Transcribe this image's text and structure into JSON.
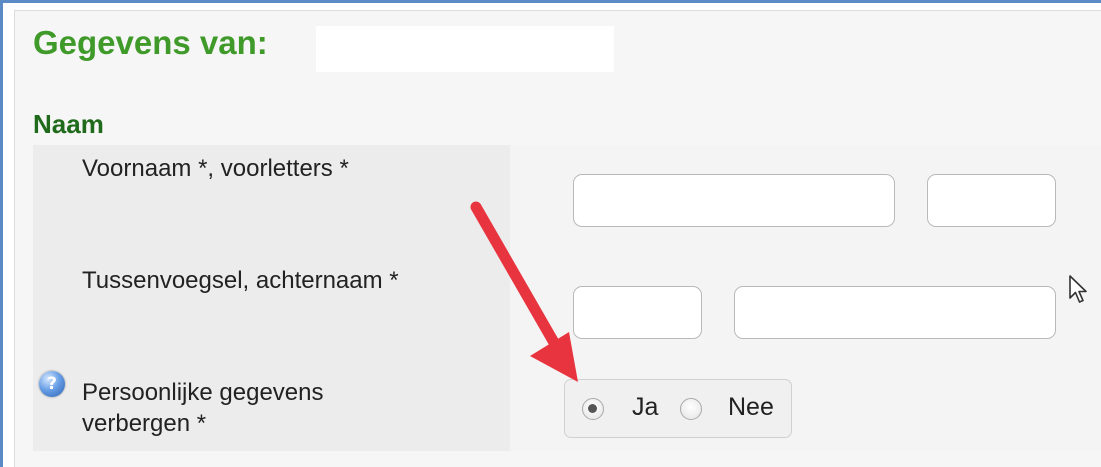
{
  "header": {
    "title": "Gegevens van:",
    "name_value": ""
  },
  "section": {
    "title": "Naam"
  },
  "fields": {
    "voornaam_label": "Voornaam *, voorletters *",
    "voornaam_value": "",
    "voorletters_value": "",
    "tussenvoegsel_label": "Tussenvoegsel, achternaam *",
    "tussenvoegsel_value": "",
    "achternaam_value": "",
    "privacy_label_line1": "Persoonlijke gegevens",
    "privacy_label_line2": "verbergen *"
  },
  "privacy_options": {
    "yes_label": "Ja",
    "no_label": "Nee",
    "selected": "Ja"
  },
  "colors": {
    "title_green": "#3f9a2a",
    "section_green": "#1f6b1b",
    "frame_blue": "#5b8ac6",
    "arrow_red": "#e8343f"
  },
  "icons": {
    "help": "question-circle-icon",
    "cursor": "mouse-pointer-icon",
    "annotation": "red-arrow"
  }
}
